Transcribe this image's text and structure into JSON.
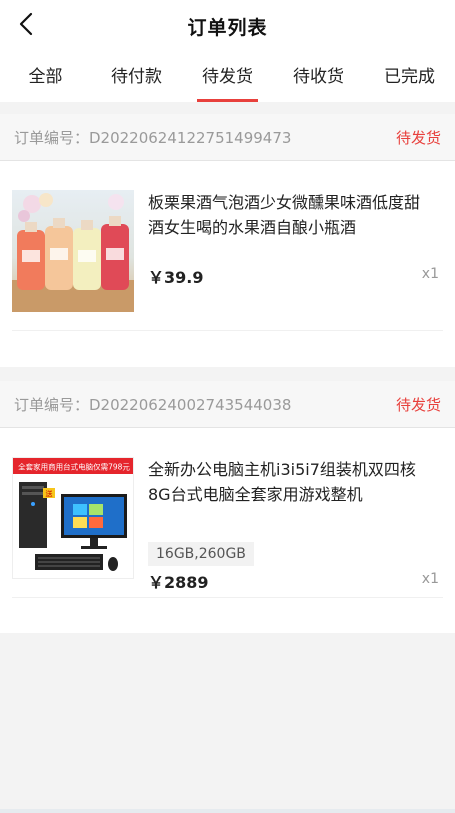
{
  "header": {
    "title": "订单列表"
  },
  "tabs": [
    {
      "label": "全部"
    },
    {
      "label": "待付款"
    },
    {
      "label": "待发货"
    },
    {
      "label": "待收货"
    },
    {
      "label": "已完成"
    }
  ],
  "active_tab": "待发货",
  "colors": {
    "accent": "#e8403c",
    "page_background": "#f3f3f3"
  },
  "orders": [
    {
      "order_no": "订单编号：D20220624122751499473",
      "status": "待发货",
      "item": {
        "title": "板栗果酒气泡酒少女微醺果味酒低度甜酒女生喝的水果酒自酿小瓶酒",
        "price": "￥39.9",
        "qty": "x1"
      }
    },
    {
      "order_no": "订单编号：D20220624002743544038",
      "status": "待发货",
      "item": {
        "title": "全新办公电脑主机i3i5i7组装机双四核8G台式电脑全套家用游戏整机",
        "spec": "16GB,260GB",
        "price": "￥2889",
        "qty": "x1",
        "image_banner": "全套家用商用台式电脑仅需798元",
        "image_badge": "送"
      }
    }
  ]
}
